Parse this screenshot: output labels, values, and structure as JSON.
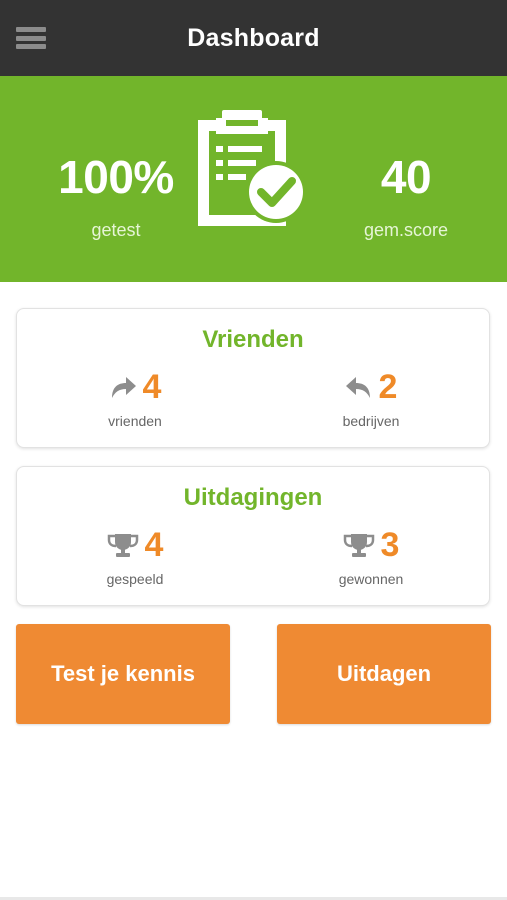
{
  "header": {
    "title": "Dashboard",
    "menu_icon": "hamburger-menu-icon"
  },
  "hero": {
    "tested_value": "100%",
    "tested_label": "getest",
    "score_value": "40",
    "score_label": "gem.score",
    "icon": "clipboard-check-icon"
  },
  "friends_card": {
    "title": "Vrienden",
    "left": {
      "value": "4",
      "label": "vrienden",
      "icon": "share-forward-icon"
    },
    "right": {
      "value": "2",
      "label": "bedrijven",
      "icon": "reply-back-icon"
    }
  },
  "challenges_card": {
    "title": "Uitdagingen",
    "left": {
      "value": "4",
      "label": "gespeeld",
      "icon": "trophy-icon"
    },
    "right": {
      "value": "3",
      "label": "gewonnen",
      "icon": "trophy-icon"
    }
  },
  "buttons": {
    "test": "Test je kennis",
    "challenge": "Uitdagen"
  },
  "colors": {
    "topbar": "#333333",
    "green": "#72b52b",
    "orange": "#ef8a28",
    "button": "#ef8a33"
  }
}
